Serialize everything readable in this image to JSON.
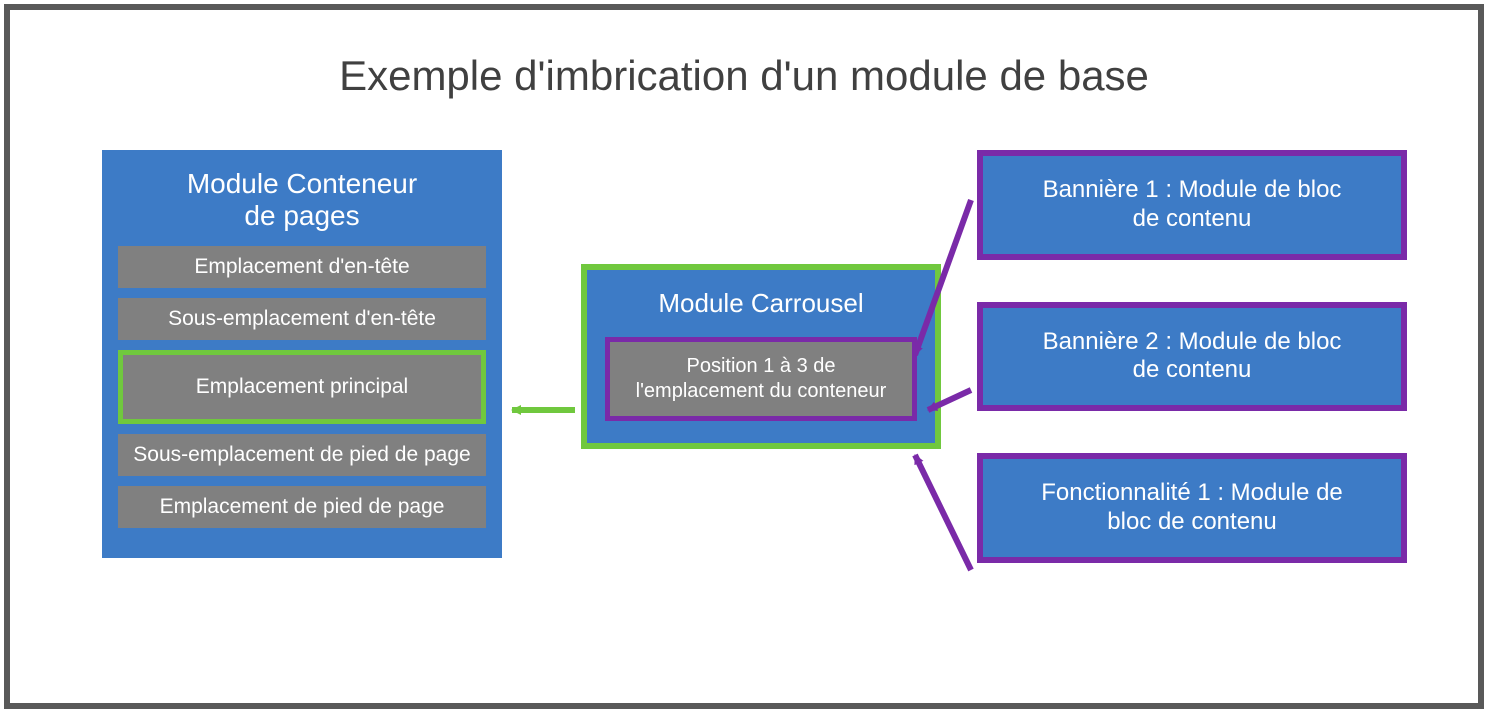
{
  "title": "Exemple d'imbrication d'un module de base",
  "colors": {
    "frame": "#595959",
    "blue": "#3d7bc6",
    "green": "#70c83e",
    "purple": "#7a2aa8",
    "gray": "#808080"
  },
  "page_container": {
    "title_line1": "Module Conteneur",
    "title_line2": "de pages",
    "slots": {
      "header": "Emplacement d'en-tête",
      "subheader": "Sous-emplacement d'en-tête",
      "main": "Emplacement principal",
      "subfooter": "Sous-emplacement de pied de page",
      "footer": "Emplacement de pied de page"
    }
  },
  "carousel": {
    "title": "Module Carrousel",
    "slot_line1": "Position 1 à 3 de",
    "slot_line2": "l'emplacement du conteneur"
  },
  "banners": {
    "b1_line1": "Bannière 1 : Module de bloc",
    "b1_line2": "de contenu",
    "b2_line1": "Bannière 2 : Module de bloc",
    "b2_line2": "de contenu",
    "b3_line1": "Fonctionnalité 1 : Module de",
    "b3_line2": "bloc de contenu"
  }
}
